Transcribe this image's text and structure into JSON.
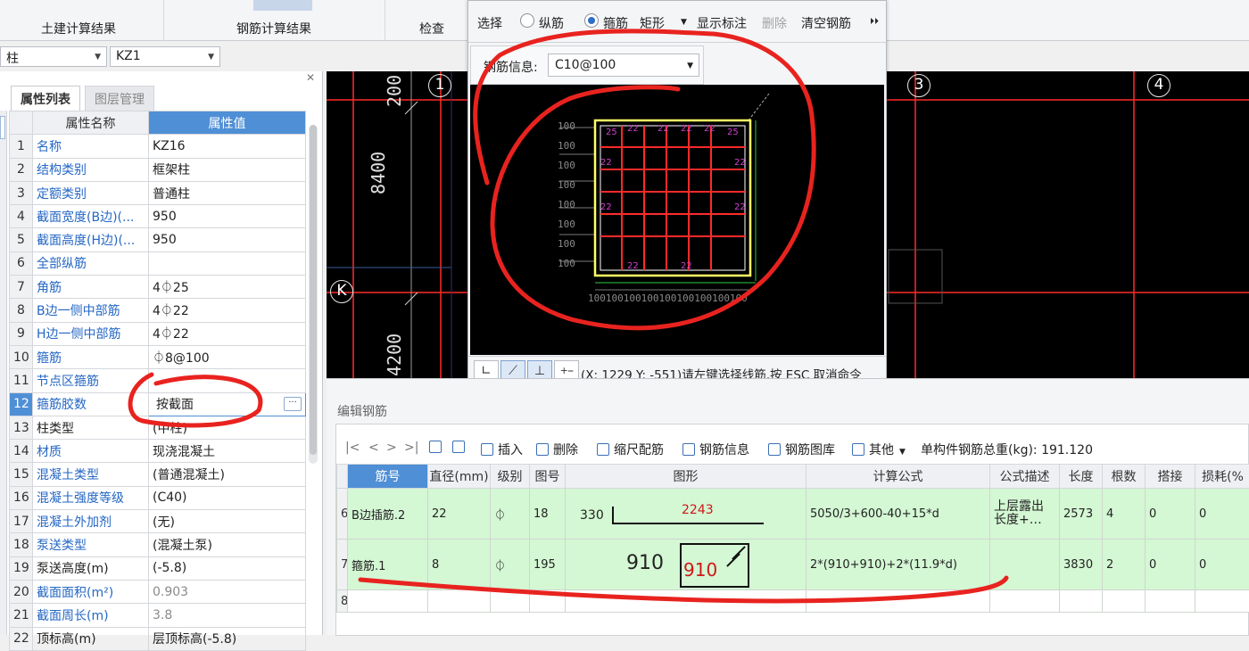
{
  "ribbon": {
    "tab_civil": "土建计算结果",
    "tab_rebar": "钢筋计算结果",
    "tab_check": "检查"
  },
  "selector": {
    "type_value": "柱",
    "component_value": "KZ1"
  },
  "property_panel": {
    "tab_properties": "属性列表",
    "tab_layers": "图层管理",
    "col_name": "属性名称",
    "col_value": "属性值",
    "rows": [
      {
        "idx": "1",
        "name": "名称",
        "value": "KZ16"
      },
      {
        "idx": "2",
        "name": "结构类别",
        "value": "框架柱"
      },
      {
        "idx": "3",
        "name": "定额类别",
        "value": "普通柱"
      },
      {
        "idx": "4",
        "name": "截面宽度(B边)(...",
        "value": "950"
      },
      {
        "idx": "5",
        "name": "截面高度(H边)(...",
        "value": "950"
      },
      {
        "idx": "6",
        "name": "全部纵筋",
        "value": ""
      },
      {
        "idx": "7",
        "name": "角筋",
        "value": "4⏀25"
      },
      {
        "idx": "8",
        "name": "B边一侧中部筋",
        "value": "4⏀22"
      },
      {
        "idx": "9",
        "name": "H边一侧中部筋",
        "value": "4⏀22"
      },
      {
        "idx": "10",
        "name": "箍筋",
        "value": "⏀8@100"
      },
      {
        "idx": "11",
        "name": "节点区箍筋",
        "value": ""
      },
      {
        "idx": "12",
        "name": "箍筋胶数",
        "value": "按截面"
      },
      {
        "idx": "13",
        "name": "柱类型",
        "value": "(中柱)"
      },
      {
        "idx": "14",
        "name": "材质",
        "value": "现浇混凝土"
      },
      {
        "idx": "15",
        "name": "混凝土类型",
        "value": "(普通混凝土)"
      },
      {
        "idx": "16",
        "name": "混凝土强度等级",
        "value": "(C40)"
      },
      {
        "idx": "17",
        "name": "混凝土外加剂",
        "value": "(无)"
      },
      {
        "idx": "18",
        "name": "泵送类型",
        "value": "(混凝土泵)"
      },
      {
        "idx": "19",
        "name": "泵送高度(m)",
        "value": "(-5.8)"
      },
      {
        "idx": "20",
        "name": "截面面积(m²)",
        "value": "0.903"
      },
      {
        "idx": "21",
        "name": "截面周长(m)",
        "value": "3.8"
      },
      {
        "idx": "22",
        "name": "顶标高(m)",
        "value": "层顶标高(-5.8)"
      }
    ]
  },
  "cad": {
    "dim_top": "200",
    "dim_mid": "8400",
    "dim_bottom": "4200",
    "axis_1": "1",
    "axis_3": "3",
    "axis_4": "4",
    "axis_k": "K"
  },
  "popup": {
    "select": "选择",
    "longitudinal": "纵筋",
    "stirrup": "箍筋",
    "shape": "矩形",
    "show_labels": "显示标注",
    "delete": "删除",
    "clear": "清空钢筋",
    "more": "⏵⏵",
    "info_label": "钢筋信息:",
    "info_value": "C10@100",
    "status_text": "(X: 1229 Y: -551)请左键选择线筋,按 ESC 取消命令"
  },
  "edit_panel": {
    "title": "编辑钢筋",
    "nav_first": "|<",
    "nav_prev": "<",
    "nav_next": ">",
    "nav_last": ">|",
    "insert": "插入",
    "delete": "删除",
    "scale": "缩尺配筋",
    "info": "钢筋信息",
    "library": "钢筋图库",
    "other": "其他",
    "total": "单构件钢筋总重(kg): 191.120",
    "headers": [
      "筋号",
      "直径(mm)",
      "级别",
      "图号",
      "图形",
      "计算公式",
      "公式描述",
      "长度",
      "根数",
      "搭接",
      "损耗(%"
    ],
    "rows": [
      {
        "rn": "6",
        "name": "B边插筋.2",
        "dia": "22",
        "grade": "⏀",
        "fig": "18",
        "shape_a": "330",
        "shape_b": "2243",
        "formula": "5050/3+600-40+15*d",
        "desc": "上层露出长度+…",
        "length": "2573",
        "count": "4",
        "lap": "0",
        "loss": "0"
      },
      {
        "rn": "7",
        "name": "箍筋.1",
        "dia": "8",
        "grade": "⏀",
        "fig": "195",
        "shape_a": "910",
        "shape_b": "910",
        "formula": "2*(910+910)+2*(11.9*d)",
        "desc": "",
        "length": "3830",
        "count": "2",
        "lap": "0",
        "loss": "0"
      },
      {
        "rn": "8"
      }
    ]
  },
  "colors": {
    "accent": "#4f8fd6",
    "row_green": "#d4f7d4",
    "annotation_red": "#e8231f",
    "cad_red": "#ff2a2a",
    "cad_yellow": "#ffff66"
  }
}
